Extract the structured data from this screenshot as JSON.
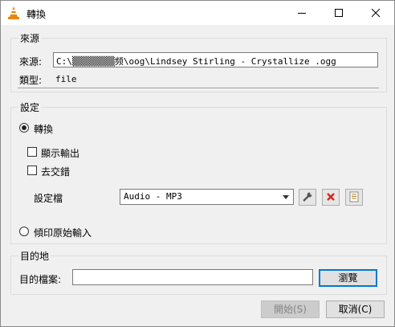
{
  "window": {
    "title": "轉換",
    "icons": {
      "app": "vlc-cone-icon",
      "minimize": "minimize-icon",
      "maximize": "maximize-icon",
      "close": "close-icon"
    }
  },
  "source_group": {
    "title": "來源",
    "source_label": "來源:",
    "source_value": "C:\\▒▒▒▒▒▒▒▒频\\oog\\Lindsey Stirling - Crystallize .ogg",
    "type_label": "類型:",
    "type_value": "file"
  },
  "settings_group": {
    "title": "設定",
    "convert_radio": {
      "label": "轉換",
      "checked": true
    },
    "show_output": {
      "label": "顯示輸出",
      "checked": false
    },
    "deinterlace": {
      "label": "去交錯",
      "checked": false
    },
    "profile_label": "設定檔",
    "profile_value": "Audio - MP3",
    "profile_icons": {
      "edit": "wrench-icon",
      "delete": "red-x-icon",
      "new": "new-profile-icon"
    },
    "dump_radio": {
      "label": "傾印原始輸入",
      "checked": false
    }
  },
  "destination_group": {
    "title": "目的地",
    "file_label": "目的檔案:",
    "file_value": "",
    "browse_label": "瀏覽"
  },
  "footer": {
    "start_label": "開始(S)",
    "cancel_label": "取消(C)"
  },
  "colors": {
    "accent": "#0078d7",
    "delete_icon": "#d9261c",
    "vlc_orange": "#f08400"
  }
}
